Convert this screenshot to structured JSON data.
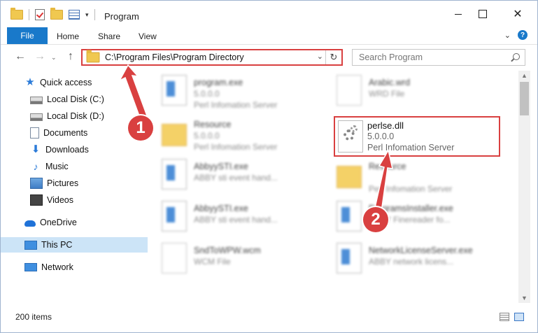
{
  "window": {
    "title": "Program",
    "minimize_label": "",
    "maximize_label": "",
    "close_label": "✕"
  },
  "ribbon": {
    "tabs": [
      "File",
      "Home",
      "Share",
      "View"
    ],
    "help_label": "?",
    "collapse_label": "⌄"
  },
  "nav": {
    "back_label": "←",
    "forward_label": "→",
    "recent_label": "⌄",
    "up_label": "↑",
    "address": "C:\\Program Files\\Program Directory",
    "address_dropdown_label": "⌄",
    "refresh_label": "↻",
    "search_placeholder": "Search Program"
  },
  "sidebar": {
    "items": [
      {
        "label": "Quick access",
        "icon": "star-icon",
        "pinned": false
      },
      {
        "label": "Local Disk (C:)",
        "icon": "disk-icon",
        "pinned": false
      },
      {
        "label": "Local Disk (D:)",
        "icon": "disk-icon",
        "pinned": false
      },
      {
        "label": "Documents",
        "icon": "documents-icon",
        "pinned": false
      },
      {
        "label": "Downloads",
        "icon": "download-icon",
        "pinned": true
      },
      {
        "label": "Music",
        "icon": "music-icon",
        "pinned": true
      },
      {
        "label": "Pictures",
        "icon": "pictures-icon",
        "pinned": true
      },
      {
        "label": "Videos",
        "icon": "videos-icon",
        "pinned": true
      },
      {
        "label": "OneDrive",
        "icon": "cloud-icon",
        "pinned": false
      },
      {
        "label": "This PC",
        "icon": "pc-icon",
        "pinned": false,
        "selected": true
      },
      {
        "label": "Network",
        "icon": "network-icon",
        "pinned": false
      }
    ],
    "pin_glyph": "📌",
    "quick_access_star": "★",
    "download_glyph": "⬇",
    "music_glyph": "♪"
  },
  "files": [
    {
      "name": "program.exe",
      "line2": "5.0.0.0",
      "line3": "Perl Infomation Server",
      "icon": "app-icon"
    },
    {
      "name": "Arabic.wrd",
      "line2": "WRD File",
      "line3": "",
      "icon": "page-icon"
    },
    {
      "name": "Resource",
      "line2": "5.0.0.0",
      "line3": "Perl Infomation Server",
      "icon": "folder-icon"
    },
    {
      "name": "AbbyySTI.exe",
      "line2": "ABBY sti event hand...",
      "line3": "",
      "icon": "app-icon"
    },
    {
      "name": "Resource",
      "line2": "",
      "line3": "Perl Infomation Server",
      "icon": "folder-icon"
    },
    {
      "name": "AbbyySTI.exe",
      "line2": "ABBY sti event hand...",
      "line3": "",
      "icon": "app-icon"
    },
    {
      "name": "ProgramsInstaller.exe",
      "line2": "ABBY Finereader fo...",
      "line3": "",
      "icon": "app-icon"
    },
    {
      "name": "SndToWPW.wcm",
      "line2": "WCM File",
      "line3": "",
      "icon": "page-icon"
    },
    {
      "name": "NetworkLicenseServer.exe",
      "line2": "ABBY network licens...",
      "line3": "",
      "icon": "app-icon"
    }
  ],
  "focused_file": {
    "name": "perlse.dll",
    "line2": "5.0.0.0",
    "line3": "Perl Infomation Server",
    "icon": "gear-file-icon"
  },
  "scrollbar": {
    "up": "▲",
    "down": "▼"
  },
  "status": {
    "item_count": "200 items"
  },
  "annotations": {
    "step1": "1",
    "step2": "2"
  },
  "colors": {
    "accent": "#1979ca",
    "highlight": "#d94040",
    "selection": "#cce4f7"
  }
}
